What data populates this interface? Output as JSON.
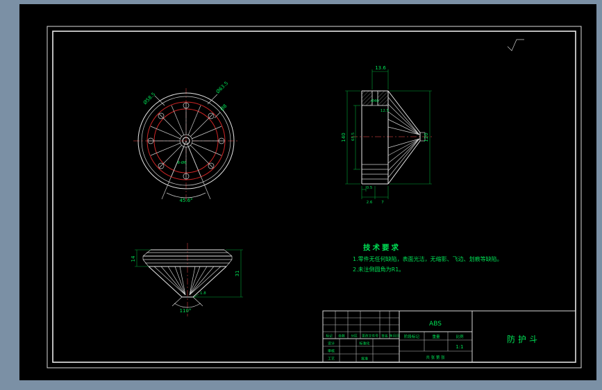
{
  "drawing": {
    "tech": {
      "title": "技术要求",
      "line1": "1.零件无任何缺陷，表面光洁，无缩影、飞边、划痕等缺陷。",
      "line2": "2.未注倒圆角为R1。"
    },
    "front_view": {
      "dia1": "Ø63.5",
      "dia2": "Ø58.5",
      "dia3": "Ø8",
      "holes": "8-Ø6",
      "angle": "45.6°"
    },
    "section_view": {
      "top_width": "13.6",
      "hole_dia": "Ø40",
      "step": "12.5",
      "height": "140",
      "inner_height": "65.5",
      "right_height": "120",
      "t1": "0.5",
      "t2": "2.6",
      "t3": "7"
    },
    "side_view": {
      "height": "31",
      "flange": "14",
      "tip": "1.8",
      "angle": "110°"
    }
  },
  "titleblock": {
    "material": "ABS",
    "part_name": "防护斗",
    "scale_value": "1:1",
    "rev_headers": [
      "标记",
      "处数",
      "分区",
      "更改文件号",
      "签名",
      "年月日"
    ],
    "sig_labels": [
      "设计",
      "标准化",
      "审核",
      "工艺",
      "批准"
    ],
    "stage_label": "阶段标记",
    "weight_label": "重量",
    "scale_label": "比例",
    "sheet_label": "共 张 第 张"
  },
  "colors": {
    "background_frame": "#7b90a5",
    "canvas": "#000000",
    "geometry": "#e8e8e8",
    "centerline_red": "#b03434",
    "circle_red": "#d02626",
    "annotation_green": "#00e055"
  }
}
